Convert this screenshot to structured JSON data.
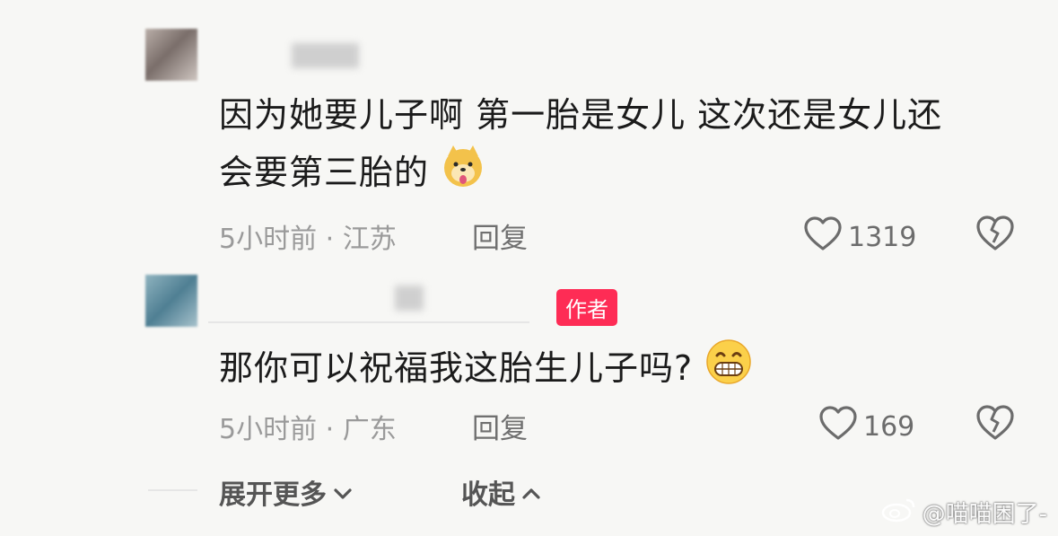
{
  "comments": [
    {
      "text": "因为她要儿子啊 第一胎是女儿 这次还是女儿还会要第三胎的",
      "line1": "因为她要儿子啊 第一胎是女儿 这次还是女儿还",
      "line2": "会要第三胎的",
      "emoji": "doge-tongue-emoji",
      "time": "5小时前",
      "location": "江苏",
      "meta": "5小时前 · 江苏",
      "reply_label": "回复",
      "likes": "1319"
    },
    {
      "badge": "作者",
      "text": "那你可以祝福我这胎生儿子吗?",
      "emoji": "grin-emoji",
      "meta": "5小时前 · 广东",
      "reply_label": "回复",
      "likes": "169"
    }
  ],
  "footer": {
    "expand_label": "展开更多",
    "collapse_label": "收起"
  },
  "watermark": "@喵喵困了-",
  "icons": {
    "like": "heart-outline-icon",
    "dislike": "broken-heart-icon",
    "expand": "chevron-down-icon",
    "collapse": "chevron-up-icon",
    "watermark": "weibo-logo-icon"
  }
}
